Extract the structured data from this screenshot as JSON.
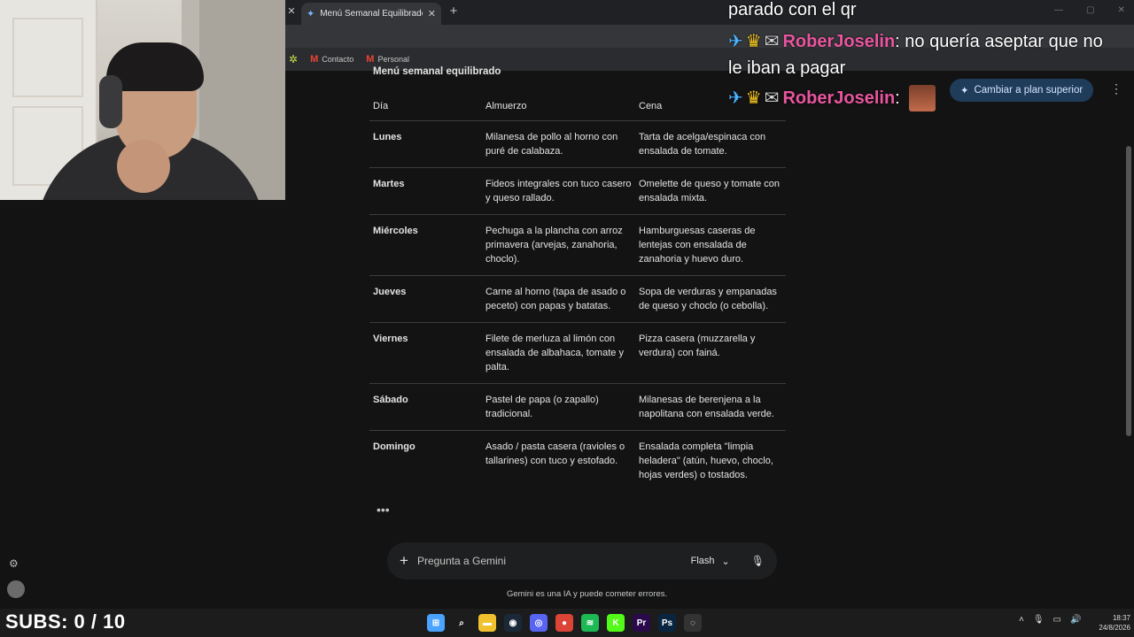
{
  "browser": {
    "active_tab_title": "Menú Semanal Equilibrado - Gemini",
    "bookmarks": [
      {
        "label": "Contacto",
        "icon": "gmail-icon"
      },
      {
        "label": "Personal",
        "icon": "gmail-icon"
      }
    ]
  },
  "chat": {
    "line1": "parado con el qr",
    "user": "RoberJoselin",
    "message": ": no quería aseptar que no",
    "line3": "le iban a pagar",
    "user2": "RoberJoselin",
    "colon": ":"
  },
  "header": {
    "upgrade_label": "Cambiar a plan superior"
  },
  "menu": {
    "title": "Menú semanal equilibrado",
    "columns": [
      "Día",
      "Almuerzo",
      "Cena"
    ],
    "rows": [
      {
        "day": "Lunes",
        "lunch": "Milanesa de pollo al horno con puré de calabaza.",
        "dinner": "Tarta de acelga/espinaca con ensalada de tomate."
      },
      {
        "day": "Martes",
        "lunch": "Fideos integrales con tuco casero y queso rallado.",
        "dinner": "Omelette de queso y tomate con ensalada mixta."
      },
      {
        "day": "Miércoles",
        "lunch": "Pechuga a la plancha con arroz primavera (arvejas, zanahoria, choclo).",
        "dinner": "Hamburguesas caseras de lentejas con ensalada de zanahoria y huevo duro."
      },
      {
        "day": "Jueves",
        "lunch": "Carne al horno (tapa de asado o peceto) con papas y batatas.",
        "dinner": "Sopa de verduras y empanadas de queso y choclo (o cebolla)."
      },
      {
        "day": "Viernes",
        "lunch": "Filete de merluza al limón con ensalada de albahaca, tomate y palta.",
        "dinner": "Pizza casera (muzzarella y verdura) con fainá."
      },
      {
        "day": "Sábado",
        "lunch": "Pastel de papa (o zapallo) tradicional.",
        "dinner": "Milanesas de berenjena a la napolitana con ensalada verde."
      },
      {
        "day": "Domingo",
        "lunch": "Asado / pasta casera (ravioles o tallarines) con tuco y estofado.",
        "dinner": "Ensalada completa \"limpia heladera\" (atún, huevo, choclo, hojas verdes) o tostados."
      }
    ]
  },
  "prompt": {
    "placeholder": "Pregunta a Gemini",
    "model": "Flash",
    "disclaimer": "Gemini es una IA y puede cometer errores."
  },
  "overlay": {
    "subs": "SUBS: 0 / 10"
  },
  "taskbar": {
    "time": "18:37",
    "date": "24/8/2026",
    "apps": [
      {
        "name": "windows-start-icon",
        "glyph": "⊞",
        "color": "#4aa3ff"
      },
      {
        "name": "search-icon",
        "glyph": "⌕",
        "color": "transparent"
      },
      {
        "name": "file-explorer-icon",
        "glyph": "▬",
        "color": "#f2c12e"
      },
      {
        "name": "steam-icon",
        "glyph": "◉",
        "color": "#1b2838"
      },
      {
        "name": "discord-icon",
        "glyph": "◎",
        "color": "#5865f2"
      },
      {
        "name": "chrome-icon",
        "glyph": "●",
        "color": "#db4437"
      },
      {
        "name": "spotify-icon",
        "glyph": "≋",
        "color": "#1db954"
      },
      {
        "name": "kick-icon",
        "glyph": "K",
        "color": "#53fc18"
      },
      {
        "name": "premiere-icon",
        "glyph": "Pr",
        "color": "#2a0a4a"
      },
      {
        "name": "photoshop-icon",
        "glyph": "Ps",
        "color": "#0a2540"
      },
      {
        "name": "obs-icon",
        "glyph": "◌",
        "color": "#333333"
      }
    ]
  }
}
